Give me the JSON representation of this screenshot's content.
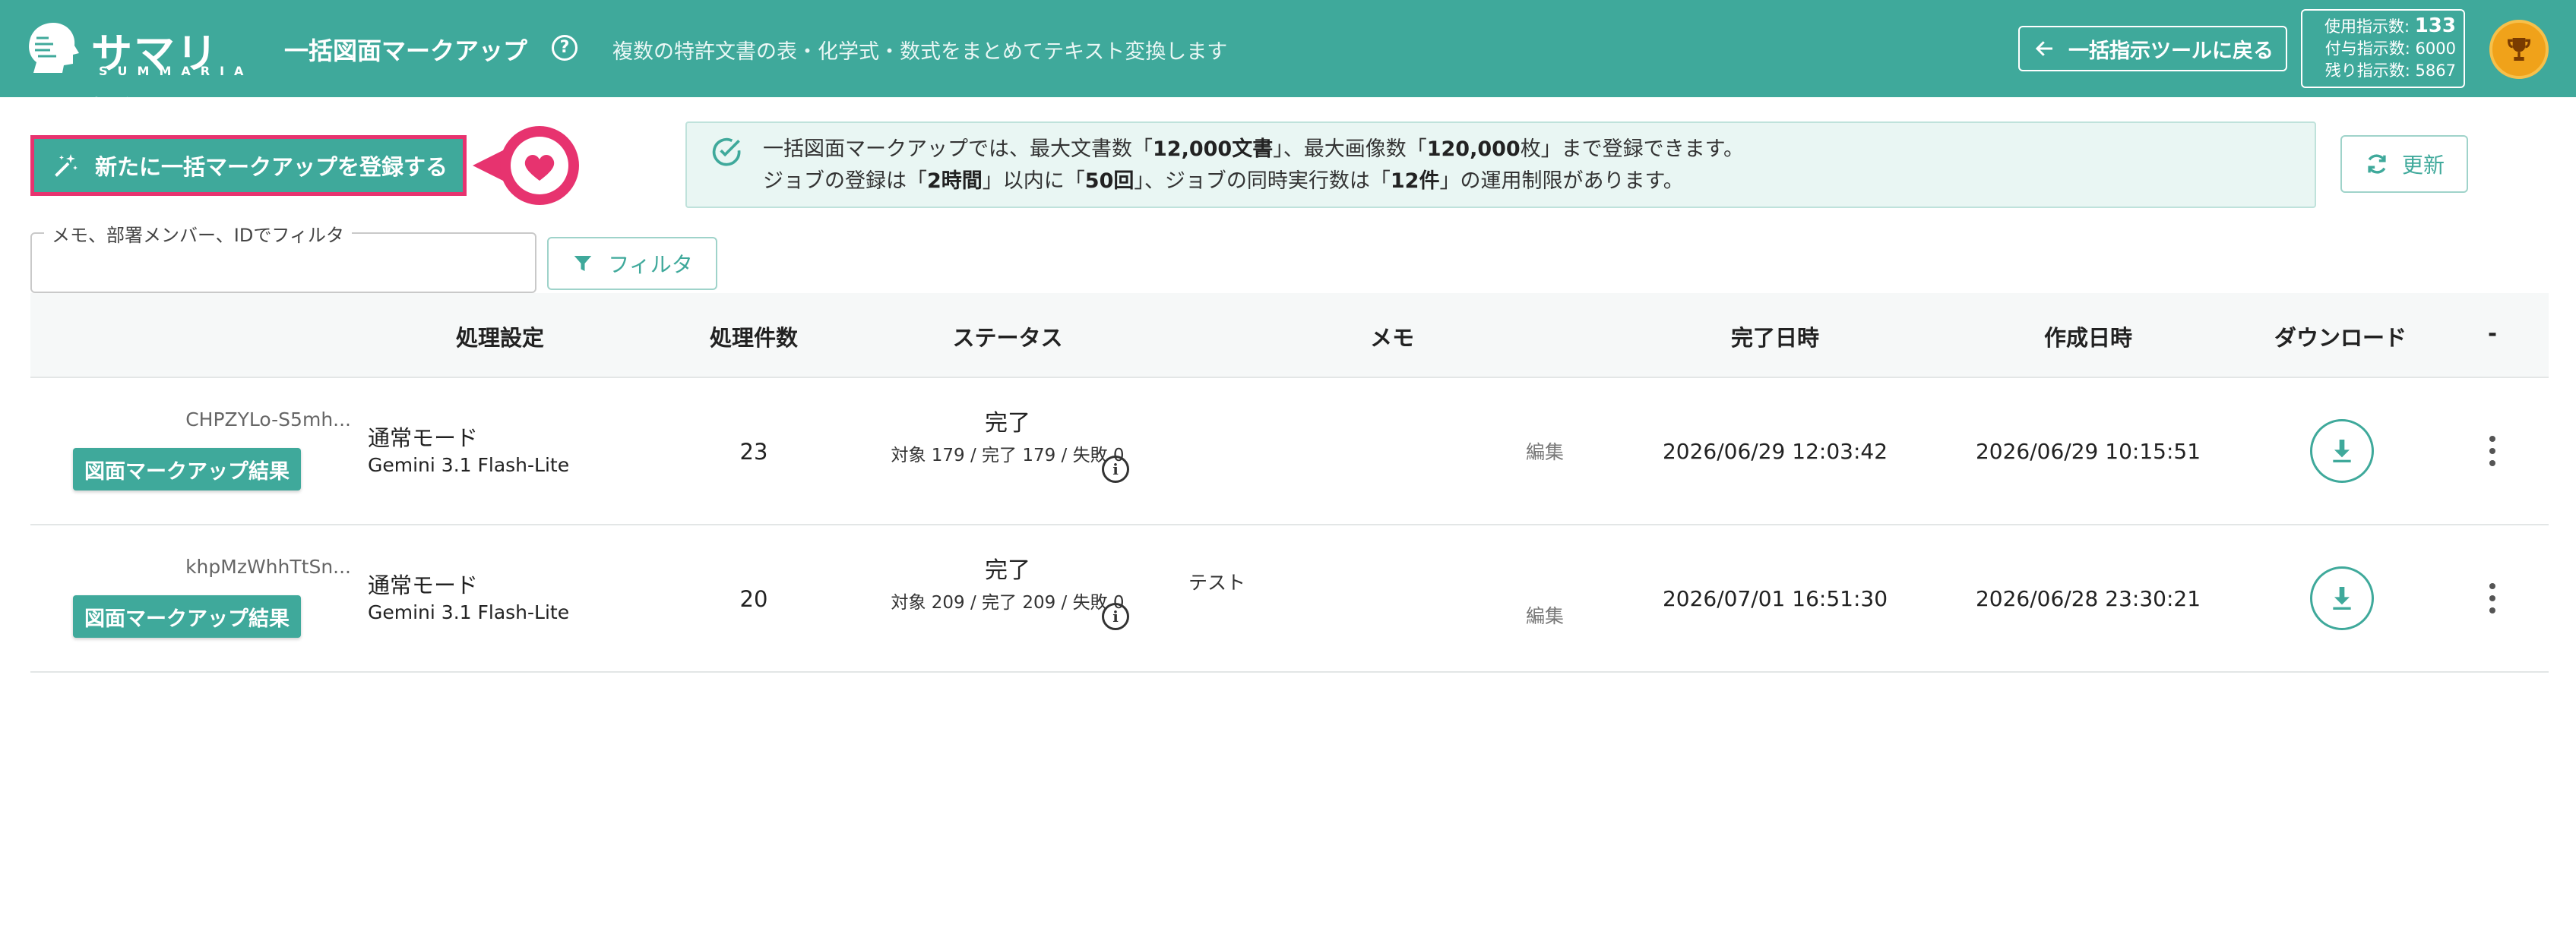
{
  "header": {
    "logo_text": "サマリア",
    "logo_sub": "SUMMARIA",
    "title": "一括図面マークアップ",
    "help_glyph": "?",
    "description": "複数の特許文書の表・化学式・数式をまとめてテキスト変換します",
    "back_label": "一括指示ツールに戻る",
    "usage_used_label": "使用指示数:",
    "usage_used_value": "133",
    "usage_granted": "付与指示数: 6000",
    "usage_remaining": "残り指示数: 5867",
    "colors": {
      "primary": "#3fa99b",
      "accent_pink": "#e7336f",
      "trophy": "#f0a21a"
    }
  },
  "controls": {
    "register_label": "新たに一括マークアップを登録する",
    "notice_line1_pre": "一括図面マークアップでは、最大文書数「",
    "notice_docs": "12,000文書",
    "notice_line1_mid": "」、最大画像数「",
    "notice_images": "120,000",
    "notice_line1_post": "枚」まで登録できます。",
    "notice_line2_pre": "ジョブの登録は「",
    "notice_hours": "2時間",
    "notice_line2_mid1": "」以内に「",
    "notice_times": "50回",
    "notice_line2_mid2": "」、ジョブの同時実行数は「",
    "notice_concurrent": "12件",
    "notice_line2_post": "」の運用制限があります。",
    "refresh_label": "更新",
    "filter_label": "メモ、部署メンバー、IDでフィルタ",
    "filter_value": "",
    "filter_button": "フィルタ"
  },
  "table": {
    "headers": [
      "処理設定",
      "処理件数",
      "ステータス",
      "メモ",
      "完了日時",
      "作成日時",
      "ダウンロード",
      "-"
    ],
    "rows": [
      {
        "id": "CHPZYLo-S5mh...",
        "result_label": "図面マークアップ結果",
        "mode": "通常モード",
        "model": "Gemini 3.1 Flash-Lite",
        "count": "23",
        "status": "完了",
        "status_detail": "対象 179 / 完了 179 / 失敗 0",
        "memo": "",
        "edit": "編集",
        "completed": "2026/06/29 12:03:42",
        "created": "2026/06/29 10:15:51"
      },
      {
        "id": "khpMzWhhTtSn...",
        "result_label": "図面マークアップ結果",
        "mode": "通常モード",
        "model": "Gemini 3.1 Flash-Lite",
        "count": "20",
        "status": "完了",
        "status_detail": "対象 209 / 完了 209 / 失敗 0",
        "memo": "テスト",
        "edit": "編集",
        "completed": "2026/07/01 16:51:30",
        "created": "2026/06/28 23:30:21"
      }
    ]
  }
}
